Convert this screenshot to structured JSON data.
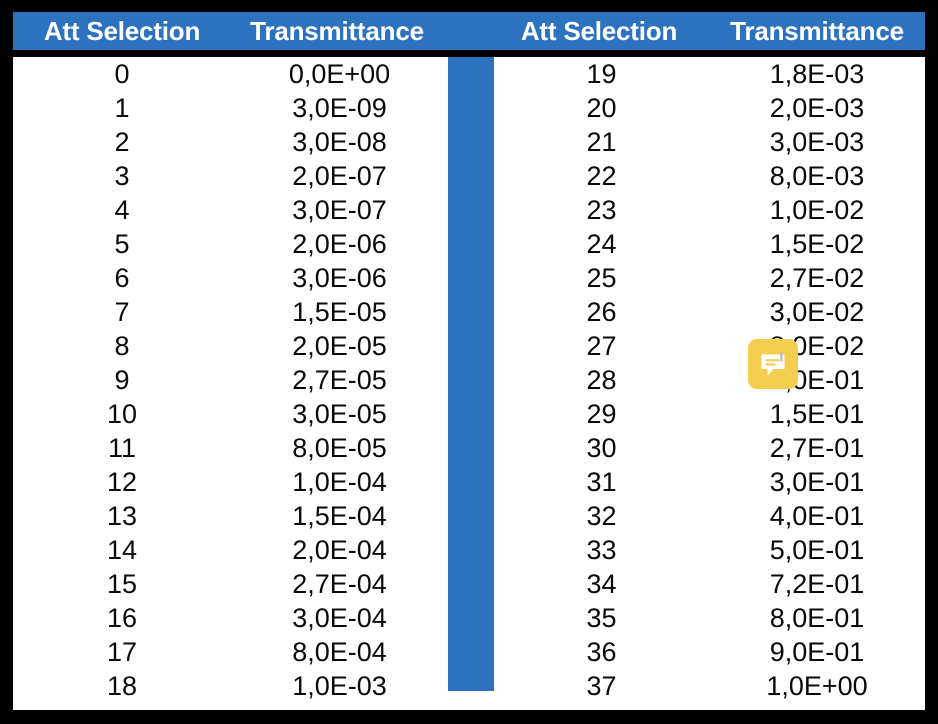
{
  "colors": {
    "accent": "#2C72BF",
    "header_text": "#FFFFFF",
    "body_text": "#0A0A0A",
    "border": "#000000",
    "icon_background": "#F4CE4E",
    "icon_glyph": "#FFFFFF"
  },
  "table": {
    "headers": {
      "att_selection_left": "Att Selection",
      "transmittance_left": "Transmittance",
      "att_selection_right": "Att Selection",
      "transmittance_right": "Transmittance"
    },
    "left_rows": [
      {
        "att": "0",
        "transmittance": "0,0E+00"
      },
      {
        "att": "1",
        "transmittance": "3,0E-09"
      },
      {
        "att": "2",
        "transmittance": "3,0E-08"
      },
      {
        "att": "3",
        "transmittance": "2,0E-07"
      },
      {
        "att": "4",
        "transmittance": "3,0E-07"
      },
      {
        "att": "5",
        "transmittance": "2,0E-06"
      },
      {
        "att": "6",
        "transmittance": "3,0E-06"
      },
      {
        "att": "7",
        "transmittance": "1,5E-05"
      },
      {
        "att": "8",
        "transmittance": "2,0E-05"
      },
      {
        "att": "9",
        "transmittance": "2,7E-05"
      },
      {
        "att": "10",
        "transmittance": "3,0E-05"
      },
      {
        "att": "11",
        "transmittance": "8,0E-05"
      },
      {
        "att": "12",
        "transmittance": "1,0E-04"
      },
      {
        "att": "13",
        "transmittance": "1,5E-04"
      },
      {
        "att": "14",
        "transmittance": "2,0E-04"
      },
      {
        "att": "15",
        "transmittance": "2,7E-04"
      },
      {
        "att": "16",
        "transmittance": "3,0E-04"
      },
      {
        "att": "17",
        "transmittance": "8,0E-04"
      },
      {
        "att": "18",
        "transmittance": "1,0E-03"
      }
    ],
    "right_rows": [
      {
        "att": "19",
        "transmittance": "1,8E-03"
      },
      {
        "att": "20",
        "transmittance": "2,0E-03"
      },
      {
        "att": "21",
        "transmittance": "3,0E-03"
      },
      {
        "att": "22",
        "transmittance": "8,0E-03"
      },
      {
        "att": "23",
        "transmittance": "1,0E-02"
      },
      {
        "att": "24",
        "transmittance": "1,5E-02"
      },
      {
        "att": "25",
        "transmittance": "2,7E-02"
      },
      {
        "att": "26",
        "transmittance": "3,0E-02"
      },
      {
        "att": "27",
        "transmittance": "8,0E-02"
      },
      {
        "att": "28",
        "transmittance": "1,0E-01"
      },
      {
        "att": "29",
        "transmittance": "1,5E-01"
      },
      {
        "att": "30",
        "transmittance": "2,7E-01"
      },
      {
        "att": "31",
        "transmittance": "3,0E-01"
      },
      {
        "att": "32",
        "transmittance": "4,0E-01"
      },
      {
        "att": "33",
        "transmittance": "5,0E-01"
      },
      {
        "att": "34",
        "transmittance": "7,2E-01"
      },
      {
        "att": "35",
        "transmittance": "8,0E-01"
      },
      {
        "att": "36",
        "transmittance": "9,0E-01"
      },
      {
        "att": "37",
        "transmittance": "1,0E+00"
      }
    ]
  },
  "overlay": {
    "comment_icon": "comment-bubble-icon"
  }
}
